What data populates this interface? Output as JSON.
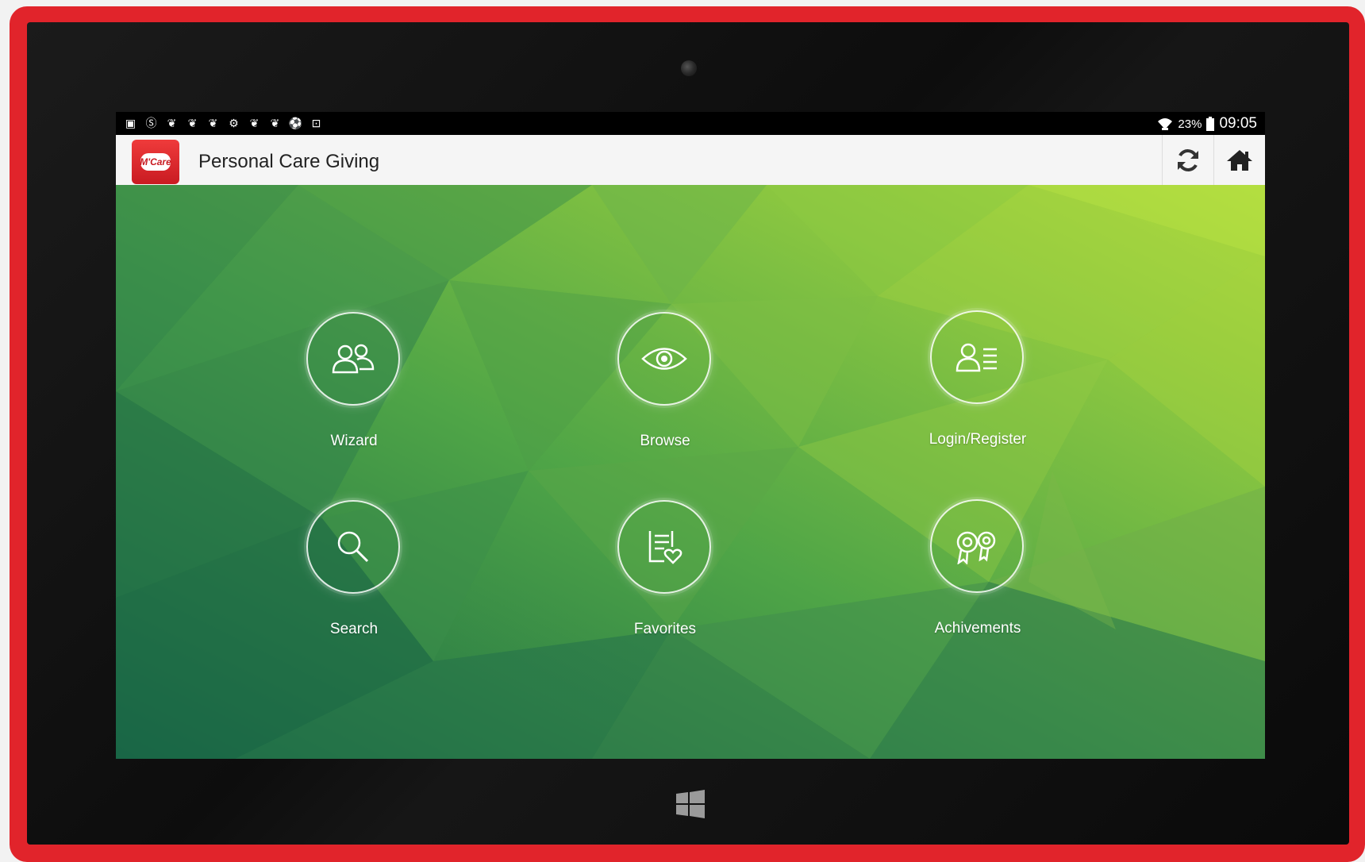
{
  "status_bar": {
    "notification_icons": [
      "image-icon",
      "skype-icon",
      "leaf-icon",
      "leaf-icon",
      "leaf-icon",
      "gear-icon",
      "leaf-icon",
      "leaf-icon",
      "soccer-ball-icon",
      "bag-icon"
    ],
    "battery": "23%",
    "time": "09:05"
  },
  "app_bar": {
    "logo_text": "M'Care",
    "title": "Personal Care Giving",
    "refresh_icon": "refresh-icon",
    "home_icon": "home-icon"
  },
  "menu": {
    "wizard": "Wizard",
    "browse": "Browse",
    "login_register": "Login/Register",
    "search": "Search",
    "favorites": "Favorites",
    "achievements": "Achivements"
  },
  "colors": {
    "frame": "#e1242b",
    "app_bar_bg": "#f5f5f5",
    "bg_dark_green": "#1f6e4a",
    "bg_light_green": "#a6d83e"
  }
}
